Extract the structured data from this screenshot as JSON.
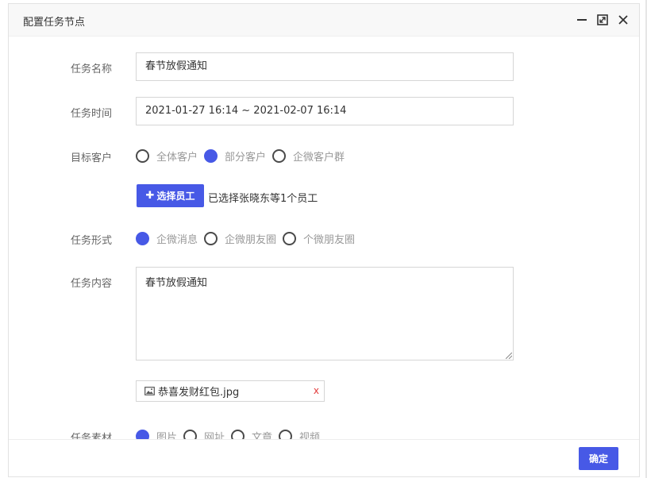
{
  "dialog": {
    "title": "配置任务节点"
  },
  "form": {
    "task_name": {
      "label": "任务名称",
      "value": "春节放假通知"
    },
    "task_time": {
      "label": "任务时间",
      "value": "2021-01-27 16:14 ~ 2021-02-07 16:14"
    },
    "target": {
      "label": "目标客户",
      "options": [
        {
          "label": "全体客户",
          "checked": false
        },
        {
          "label": "部分客户",
          "checked": true
        },
        {
          "label": "企微客户群",
          "checked": false
        }
      ]
    },
    "select_staff": {
      "button_label": "选择员工",
      "hint": "已选择张晓东等1个员工"
    },
    "form_type": {
      "label": "任务形式",
      "options": [
        {
          "label": "企微消息",
          "checked": true
        },
        {
          "label": "企微朋友圈",
          "checked": false
        },
        {
          "label": "个微朋友圈",
          "checked": false
        }
      ]
    },
    "content": {
      "label": "任务内容",
      "value": "春节放假通知"
    },
    "attachment": {
      "filename": "恭喜发财红包.jpg",
      "remove": "x"
    },
    "material": {
      "label": "任务素材",
      "options": [
        {
          "label": "图片",
          "checked": true
        },
        {
          "label": "网址",
          "checked": false
        },
        {
          "label": "文章",
          "checked": false
        },
        {
          "label": "视频",
          "checked": false
        }
      ]
    }
  },
  "footer": {
    "ok_label": "确定"
  },
  "colors": {
    "accent": "#4759e6",
    "remove": "#e23b3b"
  }
}
